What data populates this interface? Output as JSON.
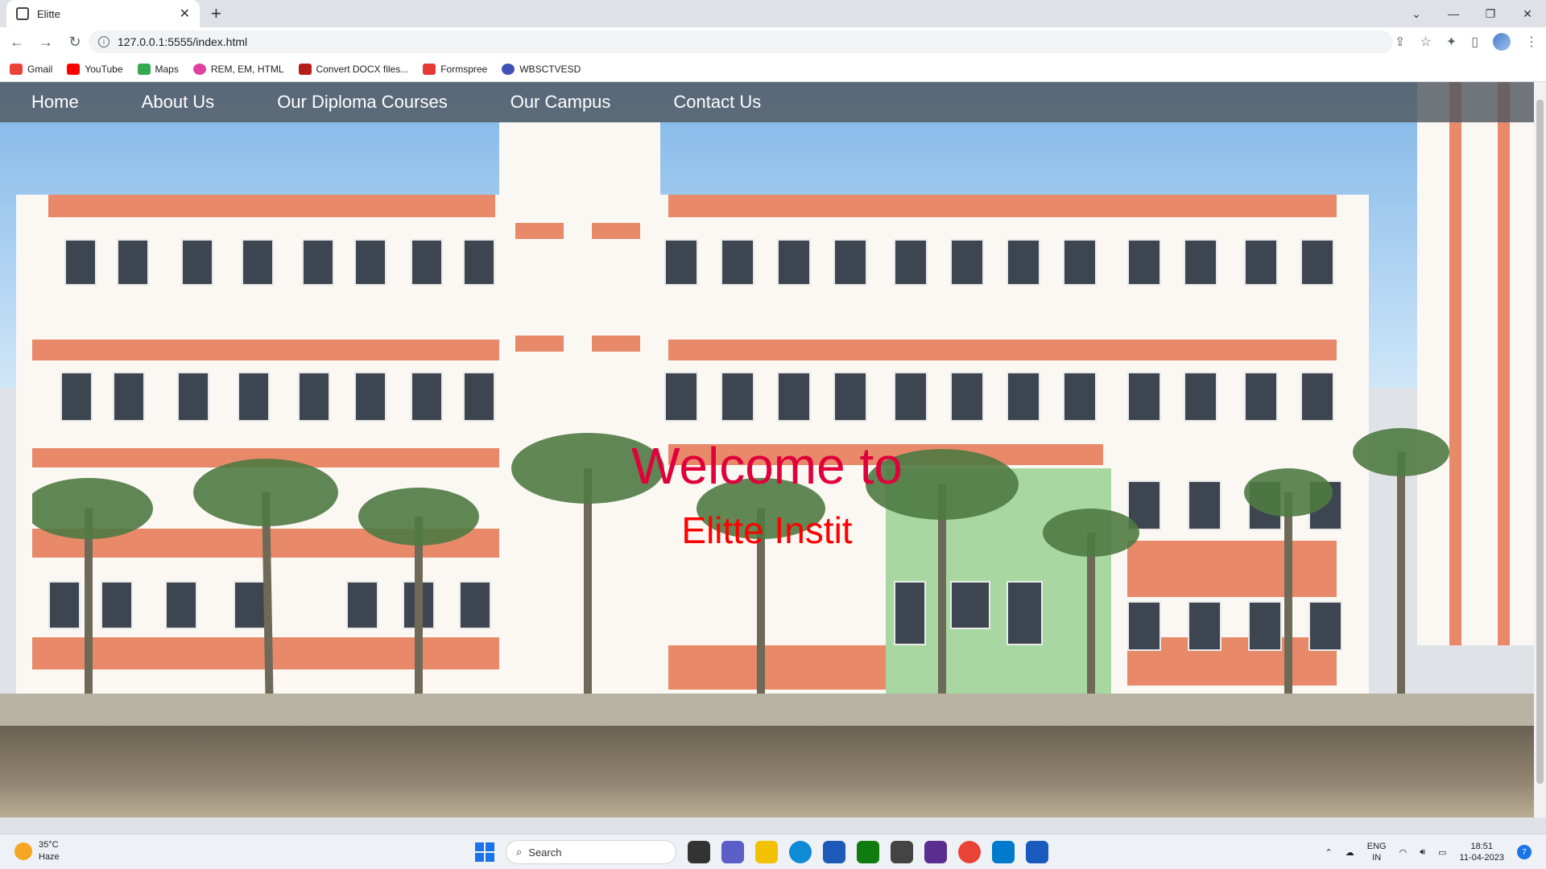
{
  "browser": {
    "tab_title": "Elitte",
    "url": "127.0.0.1:5555/index.html",
    "bookmarks": [
      "Gmail",
      "YouTube",
      "Maps",
      "REM, EM, HTML",
      "Convert DOCX files...",
      "Formspree",
      "WBSCTVESD"
    ]
  },
  "nav": {
    "items": [
      "Home",
      "About Us",
      "Our Diploma Courses",
      "Our Campus",
      "Contact Us"
    ]
  },
  "hero": {
    "welcome": "Welcome to",
    "institute": "Elitte Instit"
  },
  "taskbar": {
    "temperature": "35°C",
    "condition": "Haze",
    "search_placeholder": "Search",
    "lang_top": "ENG",
    "lang_bottom": "IN",
    "time": "18:51",
    "date": "11-04-2023",
    "notification_count": "7"
  }
}
